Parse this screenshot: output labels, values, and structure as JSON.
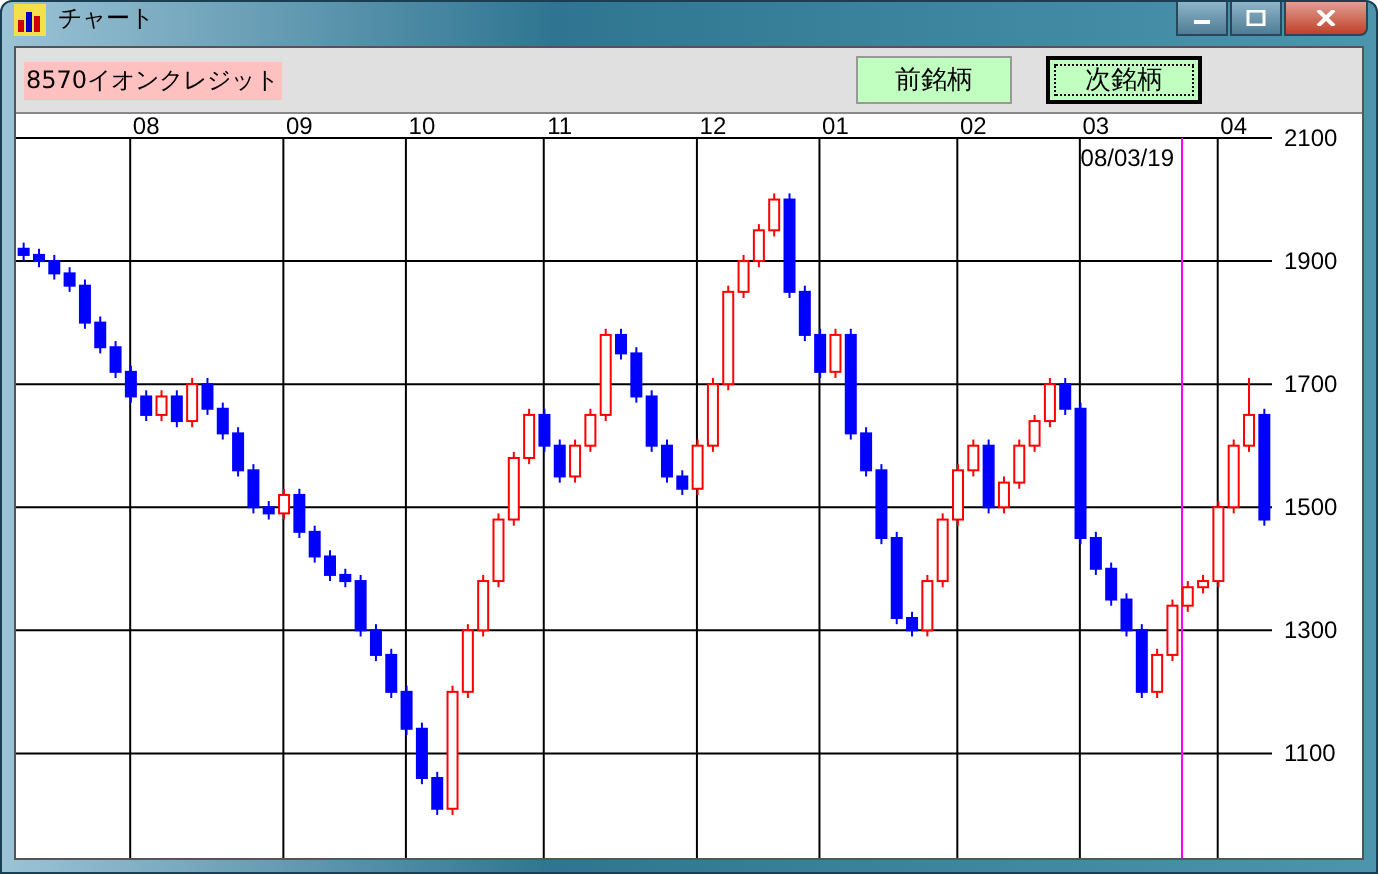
{
  "window": {
    "title": "チャート"
  },
  "stock": {
    "label": "8570イオンクレジット"
  },
  "buttons": [
    {
      "label": "前銘柄",
      "selected": false
    },
    {
      "label": "次銘柄",
      "selected": true
    }
  ],
  "chart": {
    "chart_data": {
      "type": "candlestick",
      "grid": true,
      "ylim": [
        930,
        2100
      ],
      "categories": [
        null,
        null,
        null,
        null,
        null,
        null,
        null,
        null,
        "08",
        null,
        null,
        null,
        null,
        null,
        null,
        null,
        null,
        null,
        "09",
        null,
        null,
        null,
        null,
        null,
        null,
        null,
        "10",
        null,
        null,
        null,
        null,
        null,
        null,
        null,
        null,
        "11",
        null,
        null,
        null,
        null,
        null,
        null,
        null,
        null,
        null,
        "12",
        null,
        null,
        null,
        null,
        null,
        null,
        null,
        "01",
        null,
        null,
        null,
        null,
        null,
        null,
        null,
        null,
        "02",
        null,
        null,
        null,
        null,
        null,
        null,
        null,
        "03",
        null,
        null,
        null,
        null,
        null,
        null,
        null,
        null,
        "04",
        null,
        null
      ],
      "ohlc": [
        [
          1920,
          1930,
          1900,
          1910
        ],
        [
          1910,
          1920,
          1890,
          1900
        ],
        [
          1900,
          1910,
          1870,
          1880
        ],
        [
          1880,
          1890,
          1850,
          1860
        ],
        [
          1860,
          1870,
          1790,
          1800
        ],
        [
          1800,
          1810,
          1750,
          1760
        ],
        [
          1760,
          1770,
          1710,
          1720
        ],
        [
          1720,
          1730,
          1670,
          1680
        ],
        [
          1680,
          1690,
          1640,
          1650
        ],
        [
          1650,
          1690,
          1640,
          1680
        ],
        [
          1680,
          1690,
          1630,
          1640
        ],
        [
          1640,
          1710,
          1630,
          1700
        ],
        [
          1700,
          1710,
          1650,
          1660
        ],
        [
          1660,
          1670,
          1610,
          1620
        ],
        [
          1620,
          1630,
          1550,
          1560
        ],
        [
          1560,
          1570,
          1490,
          1500
        ],
        [
          1500,
          1510,
          1480,
          1490
        ],
        [
          1490,
          1530,
          1480,
          1520
        ],
        [
          1520,
          1530,
          1450,
          1460
        ],
        [
          1460,
          1470,
          1410,
          1420
        ],
        [
          1420,
          1430,
          1380,
          1390
        ],
        [
          1390,
          1400,
          1370,
          1380
        ],
        [
          1380,
          1390,
          1290,
          1300
        ],
        [
          1300,
          1310,
          1250,
          1260
        ],
        [
          1260,
          1270,
          1190,
          1200
        ],
        [
          1200,
          1210,
          1130,
          1140
        ],
        [
          1140,
          1150,
          1050,
          1060
        ],
        [
          1060,
          1070,
          1000,
          1010
        ],
        [
          1010,
          1210,
          1000,
          1200
        ],
        [
          1200,
          1310,
          1190,
          1300
        ],
        [
          1300,
          1390,
          1290,
          1380
        ],
        [
          1380,
          1490,
          1370,
          1480
        ],
        [
          1480,
          1590,
          1470,
          1580
        ],
        [
          1580,
          1660,
          1570,
          1650
        ],
        [
          1650,
          1660,
          1590,
          1600
        ],
        [
          1600,
          1610,
          1540,
          1550
        ],
        [
          1550,
          1610,
          1540,
          1600
        ],
        [
          1600,
          1660,
          1590,
          1650
        ],
        [
          1650,
          1790,
          1640,
          1780
        ],
        [
          1780,
          1790,
          1740,
          1750
        ],
        [
          1750,
          1760,
          1670,
          1680
        ],
        [
          1680,
          1690,
          1590,
          1600
        ],
        [
          1600,
          1610,
          1540,
          1550
        ],
        [
          1550,
          1560,
          1520,
          1530
        ],
        [
          1530,
          1610,
          1520,
          1600
        ],
        [
          1600,
          1710,
          1590,
          1700
        ],
        [
          1700,
          1860,
          1690,
          1850
        ],
        [
          1850,
          1910,
          1840,
          1900
        ],
        [
          1900,
          1960,
          1890,
          1950
        ],
        [
          1950,
          2010,
          1940,
          2000
        ],
        [
          2000,
          2010,
          1840,
          1850
        ],
        [
          1850,
          1860,
          1770,
          1780
        ],
        [
          1780,
          1790,
          1710,
          1720
        ],
        [
          1720,
          1790,
          1710,
          1780
        ],
        [
          1780,
          1790,
          1610,
          1620
        ],
        [
          1620,
          1630,
          1550,
          1560
        ],
        [
          1560,
          1570,
          1440,
          1450
        ],
        [
          1450,
          1460,
          1310,
          1320
        ],
        [
          1320,
          1330,
          1290,
          1300
        ],
        [
          1300,
          1390,
          1290,
          1380
        ],
        [
          1380,
          1490,
          1370,
          1480
        ],
        [
          1480,
          1570,
          1470,
          1560
        ],
        [
          1560,
          1610,
          1550,
          1600
        ],
        [
          1600,
          1610,
          1490,
          1500
        ],
        [
          1500,
          1550,
          1490,
          1540
        ],
        [
          1540,
          1610,
          1530,
          1600
        ],
        [
          1600,
          1650,
          1590,
          1640
        ],
        [
          1640,
          1710,
          1630,
          1700
        ],
        [
          1700,
          1710,
          1650,
          1660
        ],
        [
          1660,
          1670,
          1440,
          1450
        ],
        [
          1450,
          1460,
          1390,
          1400
        ],
        [
          1400,
          1410,
          1340,
          1350
        ],
        [
          1350,
          1360,
          1290,
          1300
        ],
        [
          1300,
          1310,
          1190,
          1200
        ],
        [
          1200,
          1270,
          1190,
          1260
        ],
        [
          1260,
          1350,
          1250,
          1340
        ],
        [
          1340,
          1380,
          1330,
          1370
        ],
        [
          1370,
          1390,
          1360,
          1380
        ],
        [
          1380,
          1510,
          1370,
          1500
        ],
        [
          1500,
          1610,
          1490,
          1600
        ],
        [
          1600,
          1710,
          1590,
          1650
        ],
        [
          1650,
          1660,
          1470,
          1480
        ]
      ],
      "yticks": [
        1100,
        1300,
        1500,
        1700,
        1900,
        2100
      ],
      "annotations": [
        "08/03/19"
      ]
    }
  }
}
